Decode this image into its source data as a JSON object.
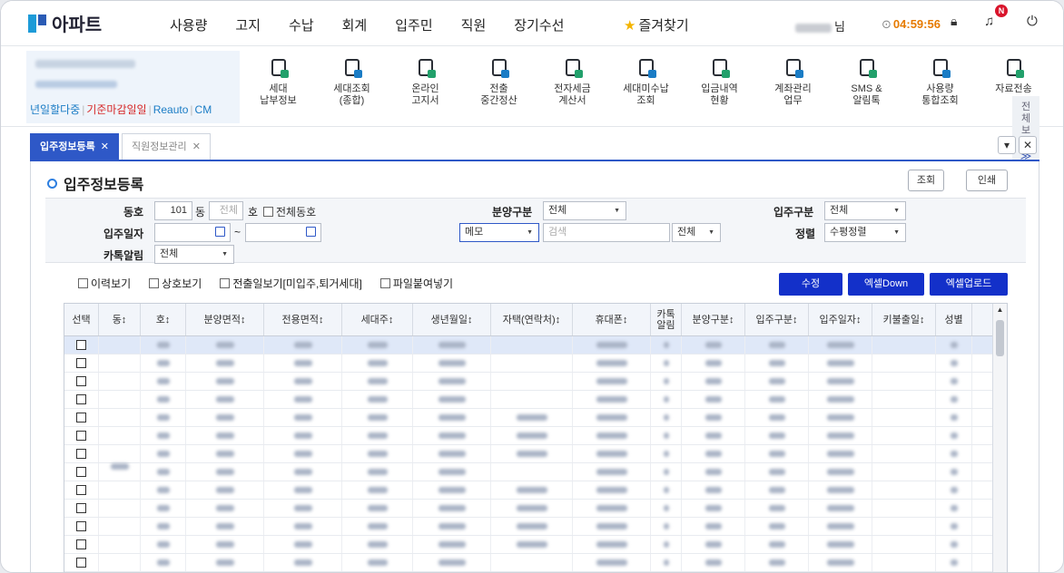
{
  "app": {
    "logo_text": "아파트"
  },
  "nav": {
    "items": [
      "사용량",
      "고지",
      "수납",
      "회계",
      "입주민",
      "직원",
      "장기수선"
    ],
    "favorites": "즐겨찾기",
    "user_suffix": "님",
    "timer": "04:59:56",
    "notification_badge": "N"
  },
  "quick": {
    "links": [
      {
        "text": "년일할다중",
        "color": "#1a7cc5"
      },
      {
        "text": "기준마감일일",
        "color": "#d62828"
      },
      {
        "text": "Reauto",
        "color": "#1a7cc5"
      },
      {
        "text": "CM",
        "color": "#1a7cc5"
      }
    ],
    "items": [
      {
        "label": "세대\n납부정보",
        "icon": "household-payment-icon"
      },
      {
        "label": "세대조회\n(종합)",
        "icon": "household-search-icon"
      },
      {
        "label": "온라인\n고지서",
        "icon": "online-bill-icon"
      },
      {
        "label": "전출\n중간정산",
        "icon": "moveout-settlement-icon"
      },
      {
        "label": "전자세금\n계산서",
        "icon": "e-tax-invoice-icon"
      },
      {
        "label": "세대미수납\n조회",
        "icon": "unpaid-search-icon"
      },
      {
        "label": "입금내역\n현황",
        "icon": "deposit-history-icon"
      },
      {
        "label": "계좌관리\n업무",
        "icon": "account-management-icon"
      },
      {
        "label": "SMS &\n알림톡",
        "icon": "sms-icon"
      },
      {
        "label": "사용량\n통합조회",
        "icon": "usage-lookup-icon"
      },
      {
        "label": "자료전송",
        "icon": "data-transfer-icon"
      }
    ],
    "full_view": "전\n체\n보\n기"
  },
  "tabs": [
    {
      "label": "입주정보등록",
      "active": true
    },
    {
      "label": "직원정보관리",
      "active": false
    }
  ],
  "page": {
    "title": "입주정보등록",
    "search_button": "조회",
    "print_button": "인쇄"
  },
  "form": {
    "dong_label": "동호",
    "dong_value": "101",
    "dong_unit": "동",
    "ho_placeholder": "전체",
    "ho_unit": "호",
    "all_dongho": "전체동호",
    "sale_type_label": "분양구분",
    "sale_type_value": "전체",
    "move_type_label": "입주구분",
    "move_type_value": "전체",
    "move_date_label": "입주일자",
    "date_sep": "~",
    "memo_select": "메모",
    "search_placeholder": "검색",
    "search_scope": "전체",
    "sort_label": "정렬",
    "sort_value": "수평정렬",
    "kakao_label": "카톡알림",
    "kakao_value": "전체"
  },
  "options": [
    "이력보기",
    "상호보기",
    "전출일보기[미입주,퇴거세대]",
    "파일붙여넣기"
  ],
  "actions": {
    "edit": "수정",
    "excel_down": "엑셀Down",
    "excel_upload": "엑셀업로드"
  },
  "table": {
    "columns": [
      "선택",
      "동↕",
      "호↕",
      "분양면적↕",
      "전용면적↕",
      "세대주↕",
      "생년월일↕",
      "자택(연락처)↕",
      "휴대폰↕",
      "카톡\n알림",
      "분양구분↕",
      "입주구분↕",
      "입주일자↕",
      "키불출일↕",
      "성별"
    ],
    "row_count": 13
  }
}
